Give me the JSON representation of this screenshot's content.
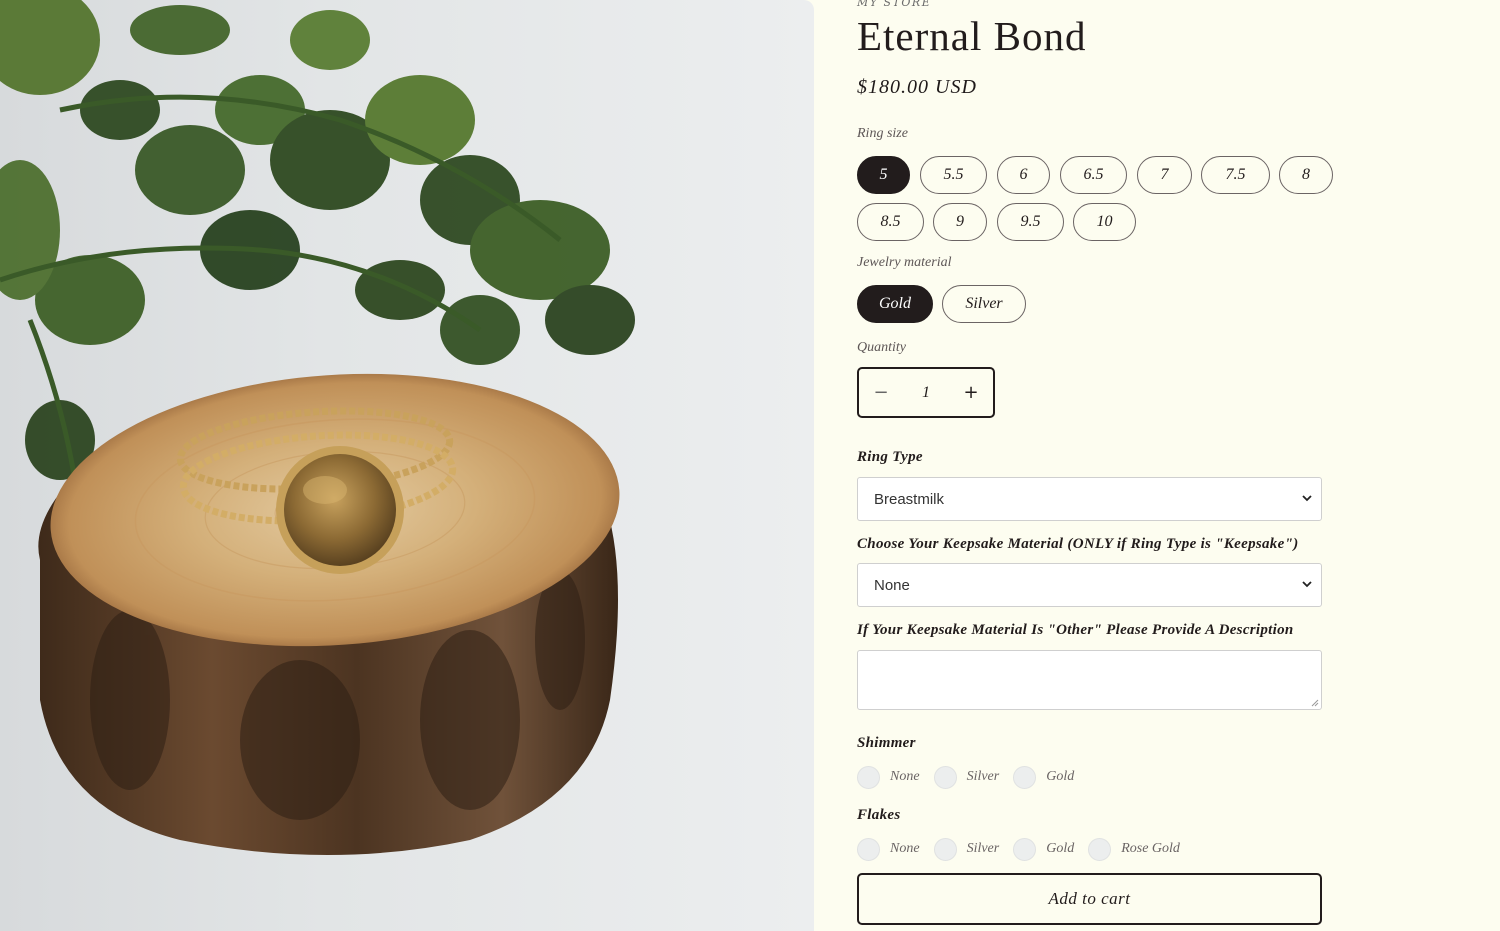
{
  "product": {
    "vendor": "MY STORE",
    "title": "Eternal Bond",
    "price": "$180.00 USD",
    "image_alt": "Gold twisted ring stack on wooden slice"
  },
  "ring_size": {
    "label": "Ring size",
    "options": [
      "5",
      "5.5",
      "6",
      "6.5",
      "7",
      "7.5",
      "8",
      "8.5",
      "9",
      "9.5",
      "10"
    ],
    "selected": "5"
  },
  "material": {
    "label": "Jewelry material",
    "options": [
      "Gold",
      "Silver"
    ],
    "selected": "Gold"
  },
  "quantity": {
    "label": "Quantity",
    "value": "1",
    "minus": "−",
    "plus": "+"
  },
  "ring_type": {
    "label": "Ring Type",
    "value": "Breastmilk"
  },
  "keepsake": {
    "label": "Choose Your Keepsake Material (ONLY if Ring Type is \"Keepsake\")",
    "value": "None"
  },
  "description": {
    "label": "If Your Keepsake Material Is \"Other\" Please Provide A Description",
    "value": ""
  },
  "shimmer": {
    "label": "Shimmer",
    "options": [
      "None",
      "Silver",
      "Gold"
    ]
  },
  "flakes": {
    "label": "Flakes",
    "options": [
      "None",
      "Silver",
      "Gold",
      "Rose Gold"
    ]
  },
  "cart": {
    "label": "Add to cart"
  }
}
